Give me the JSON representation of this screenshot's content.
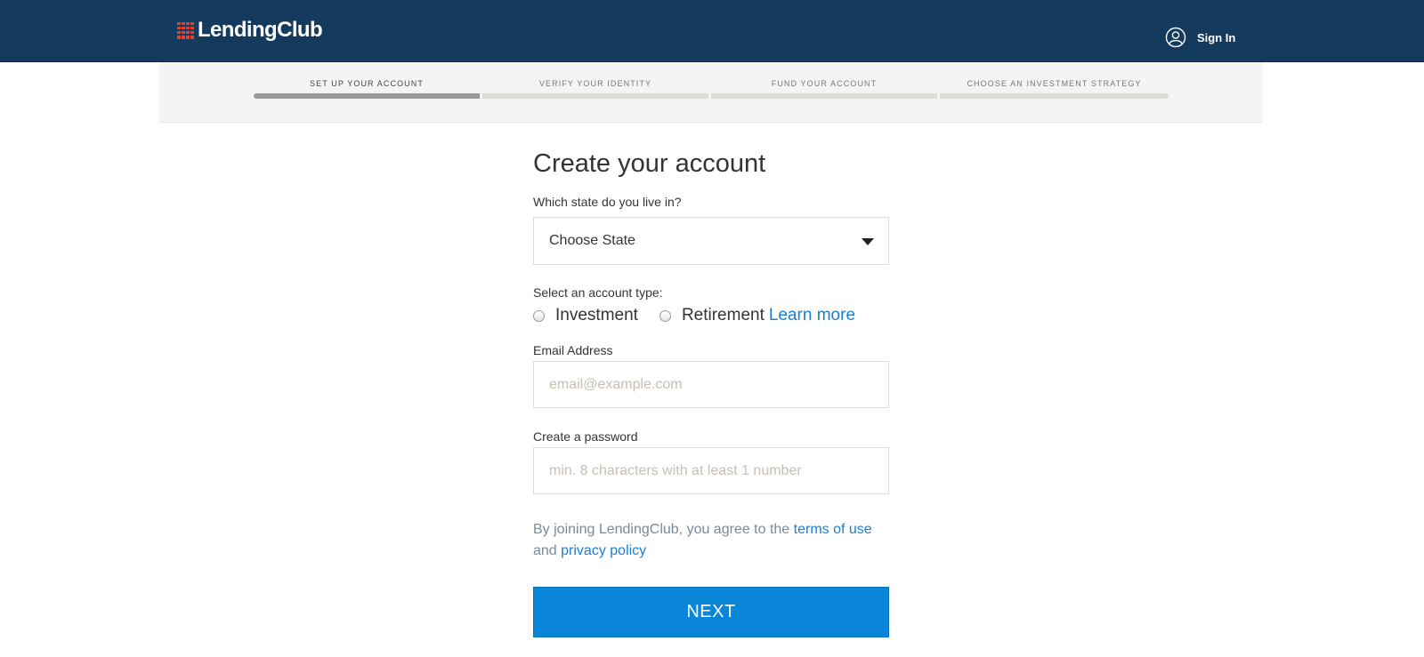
{
  "header": {
    "logo_text": "LendingClub",
    "signin_label": "Sign In",
    "bg_color": "#143a5e",
    "logo_accent": "#e2412f"
  },
  "progress": {
    "steps": [
      {
        "label": "SET UP YOUR ACCOUNT",
        "active": true
      },
      {
        "label": "VERIFY YOUR IDENTITY",
        "active": false
      },
      {
        "label": "FUND YOUR ACCOUNT",
        "active": false
      },
      {
        "label": "CHOOSE AN INVESTMENT STRATEGY",
        "active": false
      }
    ]
  },
  "form": {
    "title": "Create your account",
    "state_label": "Which state do you live in?",
    "state_value": "Choose State",
    "account_type_label": "Select an account type:",
    "account_types": [
      "Investment",
      "Retirement"
    ],
    "learn_more": "Learn more",
    "email_label": "Email Address",
    "email_placeholder": "email@example.com",
    "password_label": "Create a password",
    "password_placeholder": "min. 8 characters with at least 1 number",
    "terms_prefix": "By joining LendingClub, you agree to the ",
    "terms_link": "terms of use",
    "terms_and": "and ",
    "privacy_link": "privacy policy",
    "next_label": "NEXT",
    "next_color": "#0a86d8",
    "link_color": "#1a7fd2"
  }
}
